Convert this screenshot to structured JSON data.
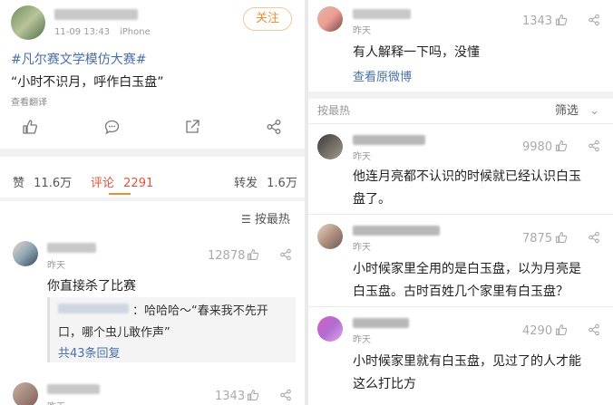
{
  "post": {
    "timestamp": "11-09 13:43",
    "device": "iPhone",
    "follow_label": "关注",
    "hashtag": "#凡尔赛文学模仿大赛#",
    "content": "“小时不识月，呼作白玉盘”",
    "translate_label": "查看翻译",
    "stats": {
      "likes_label": "赞",
      "likes_count": "11.6万",
      "comments_label": "评论",
      "comments_count": "2291",
      "reposts_label": "转发",
      "reposts_count": "1.6万"
    },
    "sort_label": "按最热"
  },
  "left_comments": [
    {
      "time": "昨天",
      "likes": "12878",
      "text": "你直接杀了比赛",
      "reply_text_line1": "：哈哈哈～“春来我不先开",
      "reply_text_line2": "口，哪个虫儿敢作声”",
      "reply_count_label": "共43条回复"
    },
    {
      "time": "昨天",
      "likes": "1343"
    }
  ],
  "right_top": {
    "time": "昨天",
    "likes": "1343",
    "text": "有人解释一下吗，没懂",
    "view_original_label": "查看原微博"
  },
  "right_section": {
    "title": "按最热",
    "filter_label": "筛选"
  },
  "right_comments": [
    {
      "time": "昨天",
      "likes": "9980",
      "line1": "他连月亮都不认识的时候就已经认识白玉",
      "line2": "盘了。"
    },
    {
      "time": "昨天",
      "likes": "7875",
      "line1": "小时候家里全用的是白玉盘，以为月亮是",
      "line2": "白玉盘。古时百姓几个家里有白玉盘？"
    },
    {
      "time": "昨天",
      "likes": "4290",
      "line1": "小时候家里就有白玉盘，见过了的人才能",
      "line2": "这么打比方"
    }
  ],
  "colors": {
    "accent_orange": "#f08c2e",
    "comment_red": "#e2533d",
    "link_blue": "#4a6fa5"
  }
}
